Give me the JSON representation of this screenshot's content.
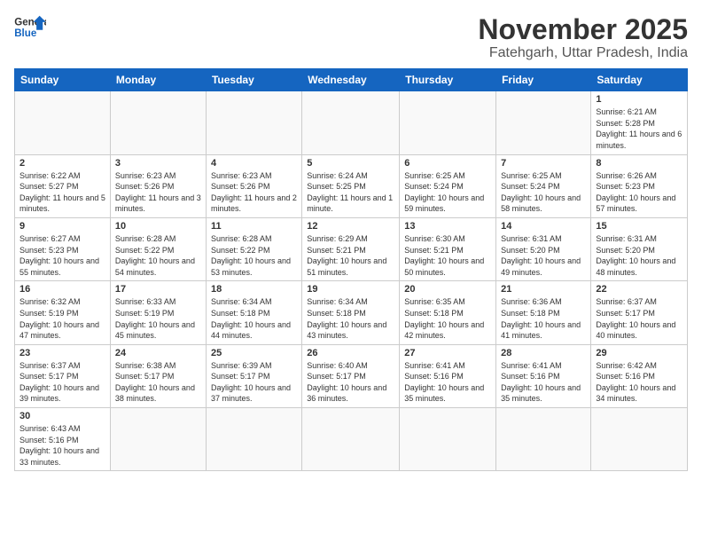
{
  "header": {
    "logo_general": "General",
    "logo_blue": "Blue",
    "month_title": "November 2025",
    "location": "Fatehgarh, Uttar Pradesh, India"
  },
  "days_of_week": [
    "Sunday",
    "Monday",
    "Tuesday",
    "Wednesday",
    "Thursday",
    "Friday",
    "Saturday"
  ],
  "weeks": [
    [
      {
        "day": "",
        "info": ""
      },
      {
        "day": "",
        "info": ""
      },
      {
        "day": "",
        "info": ""
      },
      {
        "day": "",
        "info": ""
      },
      {
        "day": "",
        "info": ""
      },
      {
        "day": "",
        "info": ""
      },
      {
        "day": "1",
        "info": "Sunrise: 6:21 AM\nSunset: 5:28 PM\nDaylight: 11 hours and 6 minutes."
      }
    ],
    [
      {
        "day": "2",
        "info": "Sunrise: 6:22 AM\nSunset: 5:27 PM\nDaylight: 11 hours and 5 minutes."
      },
      {
        "day": "3",
        "info": "Sunrise: 6:23 AM\nSunset: 5:26 PM\nDaylight: 11 hours and 3 minutes."
      },
      {
        "day": "4",
        "info": "Sunrise: 6:23 AM\nSunset: 5:26 PM\nDaylight: 11 hours and 2 minutes."
      },
      {
        "day": "5",
        "info": "Sunrise: 6:24 AM\nSunset: 5:25 PM\nDaylight: 11 hours and 1 minute."
      },
      {
        "day": "6",
        "info": "Sunrise: 6:25 AM\nSunset: 5:24 PM\nDaylight: 10 hours and 59 minutes."
      },
      {
        "day": "7",
        "info": "Sunrise: 6:25 AM\nSunset: 5:24 PM\nDaylight: 10 hours and 58 minutes."
      },
      {
        "day": "8",
        "info": "Sunrise: 6:26 AM\nSunset: 5:23 PM\nDaylight: 10 hours and 57 minutes."
      }
    ],
    [
      {
        "day": "9",
        "info": "Sunrise: 6:27 AM\nSunset: 5:23 PM\nDaylight: 10 hours and 55 minutes."
      },
      {
        "day": "10",
        "info": "Sunrise: 6:28 AM\nSunset: 5:22 PM\nDaylight: 10 hours and 54 minutes."
      },
      {
        "day": "11",
        "info": "Sunrise: 6:28 AM\nSunset: 5:22 PM\nDaylight: 10 hours and 53 minutes."
      },
      {
        "day": "12",
        "info": "Sunrise: 6:29 AM\nSunset: 5:21 PM\nDaylight: 10 hours and 51 minutes."
      },
      {
        "day": "13",
        "info": "Sunrise: 6:30 AM\nSunset: 5:21 PM\nDaylight: 10 hours and 50 minutes."
      },
      {
        "day": "14",
        "info": "Sunrise: 6:31 AM\nSunset: 5:20 PM\nDaylight: 10 hours and 49 minutes."
      },
      {
        "day": "15",
        "info": "Sunrise: 6:31 AM\nSunset: 5:20 PM\nDaylight: 10 hours and 48 minutes."
      }
    ],
    [
      {
        "day": "16",
        "info": "Sunrise: 6:32 AM\nSunset: 5:19 PM\nDaylight: 10 hours and 47 minutes."
      },
      {
        "day": "17",
        "info": "Sunrise: 6:33 AM\nSunset: 5:19 PM\nDaylight: 10 hours and 45 minutes."
      },
      {
        "day": "18",
        "info": "Sunrise: 6:34 AM\nSunset: 5:18 PM\nDaylight: 10 hours and 44 minutes."
      },
      {
        "day": "19",
        "info": "Sunrise: 6:34 AM\nSunset: 5:18 PM\nDaylight: 10 hours and 43 minutes."
      },
      {
        "day": "20",
        "info": "Sunrise: 6:35 AM\nSunset: 5:18 PM\nDaylight: 10 hours and 42 minutes."
      },
      {
        "day": "21",
        "info": "Sunrise: 6:36 AM\nSunset: 5:18 PM\nDaylight: 10 hours and 41 minutes."
      },
      {
        "day": "22",
        "info": "Sunrise: 6:37 AM\nSunset: 5:17 PM\nDaylight: 10 hours and 40 minutes."
      }
    ],
    [
      {
        "day": "23",
        "info": "Sunrise: 6:37 AM\nSunset: 5:17 PM\nDaylight: 10 hours and 39 minutes."
      },
      {
        "day": "24",
        "info": "Sunrise: 6:38 AM\nSunset: 5:17 PM\nDaylight: 10 hours and 38 minutes."
      },
      {
        "day": "25",
        "info": "Sunrise: 6:39 AM\nSunset: 5:17 PM\nDaylight: 10 hours and 37 minutes."
      },
      {
        "day": "26",
        "info": "Sunrise: 6:40 AM\nSunset: 5:17 PM\nDaylight: 10 hours and 36 minutes."
      },
      {
        "day": "27",
        "info": "Sunrise: 6:41 AM\nSunset: 5:16 PM\nDaylight: 10 hours and 35 minutes."
      },
      {
        "day": "28",
        "info": "Sunrise: 6:41 AM\nSunset: 5:16 PM\nDaylight: 10 hours and 35 minutes."
      },
      {
        "day": "29",
        "info": "Sunrise: 6:42 AM\nSunset: 5:16 PM\nDaylight: 10 hours and 34 minutes."
      }
    ],
    [
      {
        "day": "30",
        "info": "Sunrise: 6:43 AM\nSunset: 5:16 PM\nDaylight: 10 hours and 33 minutes."
      },
      {
        "day": "",
        "info": ""
      },
      {
        "day": "",
        "info": ""
      },
      {
        "day": "",
        "info": ""
      },
      {
        "day": "",
        "info": ""
      },
      {
        "day": "",
        "info": ""
      },
      {
        "day": "",
        "info": ""
      }
    ]
  ]
}
